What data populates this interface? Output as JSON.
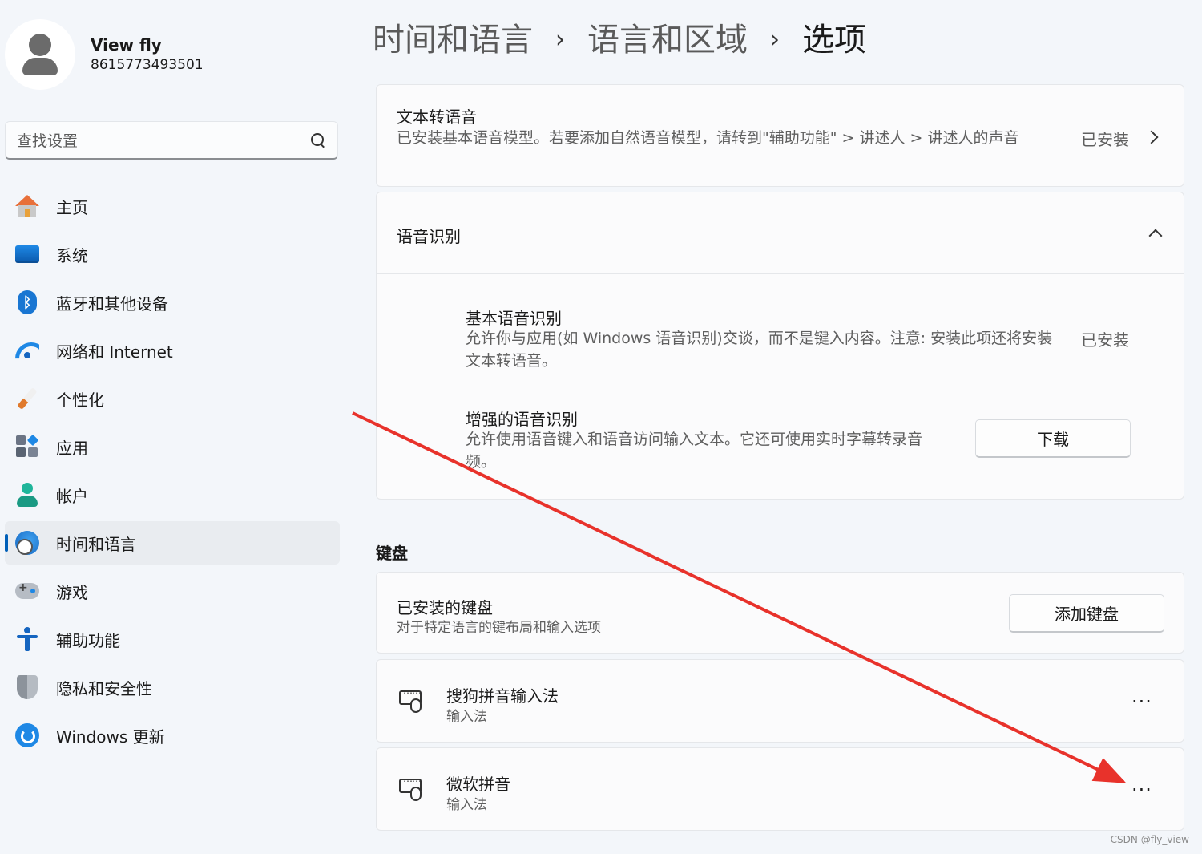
{
  "profile": {
    "name": "View fly",
    "id": "8615773493501"
  },
  "search": {
    "placeholder": "查找设置",
    "icon": "search-icon"
  },
  "sidebar": {
    "items": [
      {
        "label": "主页",
        "icon": "home-icon"
      },
      {
        "label": "系统",
        "icon": "system-icon"
      },
      {
        "label": "蓝牙和其他设备",
        "icon": "bluetooth-icon"
      },
      {
        "label": "网络和 Internet",
        "icon": "wifi-icon"
      },
      {
        "label": "个性化",
        "icon": "brush-icon"
      },
      {
        "label": "应用",
        "icon": "apps-icon"
      },
      {
        "label": "帐户",
        "icon": "account-icon"
      },
      {
        "label": "时间和语言",
        "icon": "time-language-icon",
        "active": true
      },
      {
        "label": "游戏",
        "icon": "gamepad-icon"
      },
      {
        "label": "辅助功能",
        "icon": "accessibility-icon"
      },
      {
        "label": "隐私和安全性",
        "icon": "shield-icon"
      },
      {
        "label": "Windows 更新",
        "icon": "update-icon"
      }
    ]
  },
  "breadcrumb": [
    "时间和语言",
    "语言和区域",
    "选项"
  ],
  "breadcrumb_separator": "›",
  "tts": {
    "title": "文本转语音",
    "desc": "已安装基本语音模型。若要添加自然语音模型，请转到\"辅助功能\" > 讲述人 > 讲述人的声音",
    "status": "已安装"
  },
  "speech_recognition": {
    "title": "语音识别",
    "basic": {
      "title": "基本语音识别",
      "desc": "允许你与应用(如 Windows 语音识别)交谈，而不是键入内容。注意: 安装此项还将安装文本转语音。",
      "status": "已安装"
    },
    "enhanced": {
      "title": "增强的语音识别",
      "desc": "允许使用语音键入和语音访问输入文本。它还可使用实时字幕转录音频。",
      "button": "下载"
    }
  },
  "keyboard": {
    "section_label": "键盘",
    "installed": {
      "title": "已安装的键盘",
      "desc": "对于特定语言的键布局和输入选项",
      "button": "添加键盘"
    },
    "items": [
      {
        "title": "搜狗拼音输入法",
        "subtitle": "输入法",
        "more": "···"
      },
      {
        "title": "微软拼音",
        "subtitle": "输入法",
        "more": "···"
      }
    ]
  },
  "watermark": "CSDN @fly_view",
  "colors": {
    "accent": "#005fb8",
    "annotation_arrow": "#e8322b",
    "background": "#f3f6fa"
  }
}
